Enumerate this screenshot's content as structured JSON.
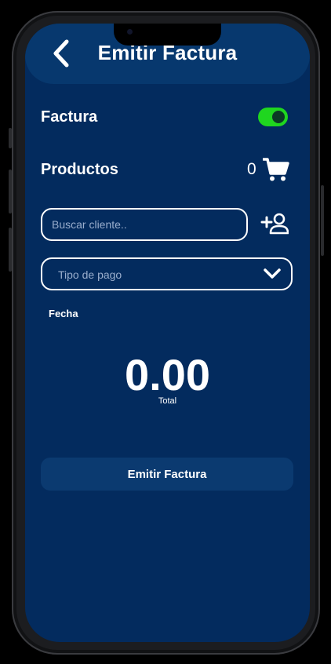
{
  "header": {
    "title": "Emitir Factura",
    "back_icon": "chevron-left-icon"
  },
  "factura": {
    "label": "Factura",
    "toggle_on": true,
    "toggle_color": "#1fd61f"
  },
  "productos": {
    "label": "Productos",
    "count": "0",
    "icon": "shopping-cart-icon"
  },
  "search": {
    "placeholder": "Buscar cliente..",
    "value": "",
    "add_icon": "add-user-icon"
  },
  "payment": {
    "placeholder": "Tipo de pago",
    "icon": "chevron-down-icon"
  },
  "fecha": {
    "label": "Fecha"
  },
  "total": {
    "value": "0.00",
    "label": "Total"
  },
  "submit": {
    "label": "Emitir Factura"
  },
  "colors": {
    "background": "#032b5e",
    "header": "#07386e",
    "button": "#0b3a70",
    "accent_green": "#1fd61f"
  }
}
